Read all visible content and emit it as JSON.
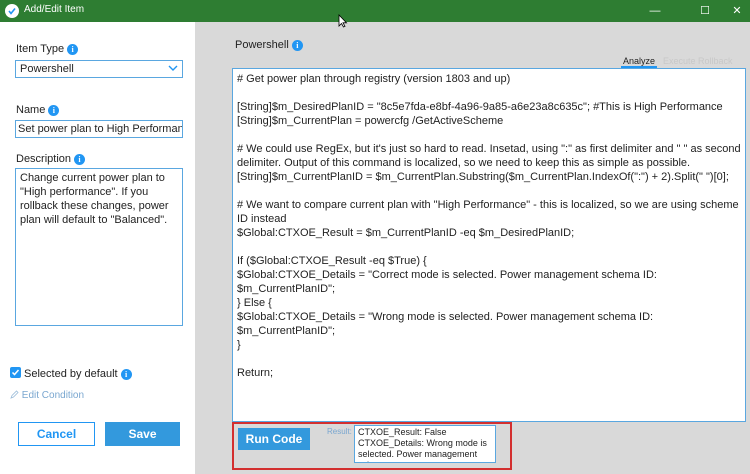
{
  "window": {
    "title": "Add/Edit Item",
    "minimize_glyph": "—",
    "maximize_glyph": "☐",
    "close_glyph": "✕"
  },
  "left_panel": {
    "item_type_label": "Item Type",
    "item_type_value": "Powershell",
    "name_label": "Name",
    "name_value": "Set power plan to High Performance",
    "description_label": "Description",
    "description_value": "Change current power plan to \"High performance\". If you rollback these changes, power plan will default to \"Balanced\".",
    "selected_by_default_label": "Selected by default",
    "selected_by_default_checked": true,
    "edit_condition_label": "Edit Condition",
    "cancel_label": "Cancel",
    "save_label": "Save"
  },
  "right_panel": {
    "section_label": "Powershell",
    "tabs": [
      {
        "label": "Analyze",
        "active": true
      },
      {
        "label": "Execute",
        "active": false
      },
      {
        "label": "Rollback",
        "active": false
      }
    ],
    "code": "# Get power plan through registry (version 1803 and up)\n\n[String]$m_DesiredPlanID = \"8c5e7fda-e8bf-4a96-9a85-a6e23a8c635c\"; #This is High Performance\n[String]$m_CurrentPlan = powercfg /GetActiveScheme\n\n# We could use RegEx, but it's just so hard to read. Insetad, using \":\" as first delimiter and \" \" as second delimiter. Output of this command is localized, so we need to keep this as simple as possible.\n[String]$m_CurrentPlanID = $m_CurrentPlan.Substring($m_CurrentPlan.IndexOf(\":\") + 2).Split(\" \")[0];\n\n# We want to compare current plan with \"High Performance\" - this is localized, so we are using scheme ID instead\n$Global:CTXOE_Result = $m_CurrentPlanID -eq $m_DesiredPlanID;\n\nIf ($Global:CTXOE_Result -eq $True) {\n$Global:CTXOE_Details = \"Correct mode is selected. Power management schema ID: $m_CurrentPlanID\";\n} Else {\n$Global:CTXOE_Details = \"Wrong mode is selected. Power management schema ID: $m_CurrentPlanID\";\n}\n\nReturn;",
    "run_code_label": "Run Code",
    "result_label": "Result:",
    "result_value": "CTXOE_Result: False\nCTXOE_Details: Wrong mode is selected. Power management schema"
  },
  "colors": {
    "titlebar": "#2e7d32",
    "accent": "#2196f3",
    "highlight_border": "#d32f2f"
  }
}
